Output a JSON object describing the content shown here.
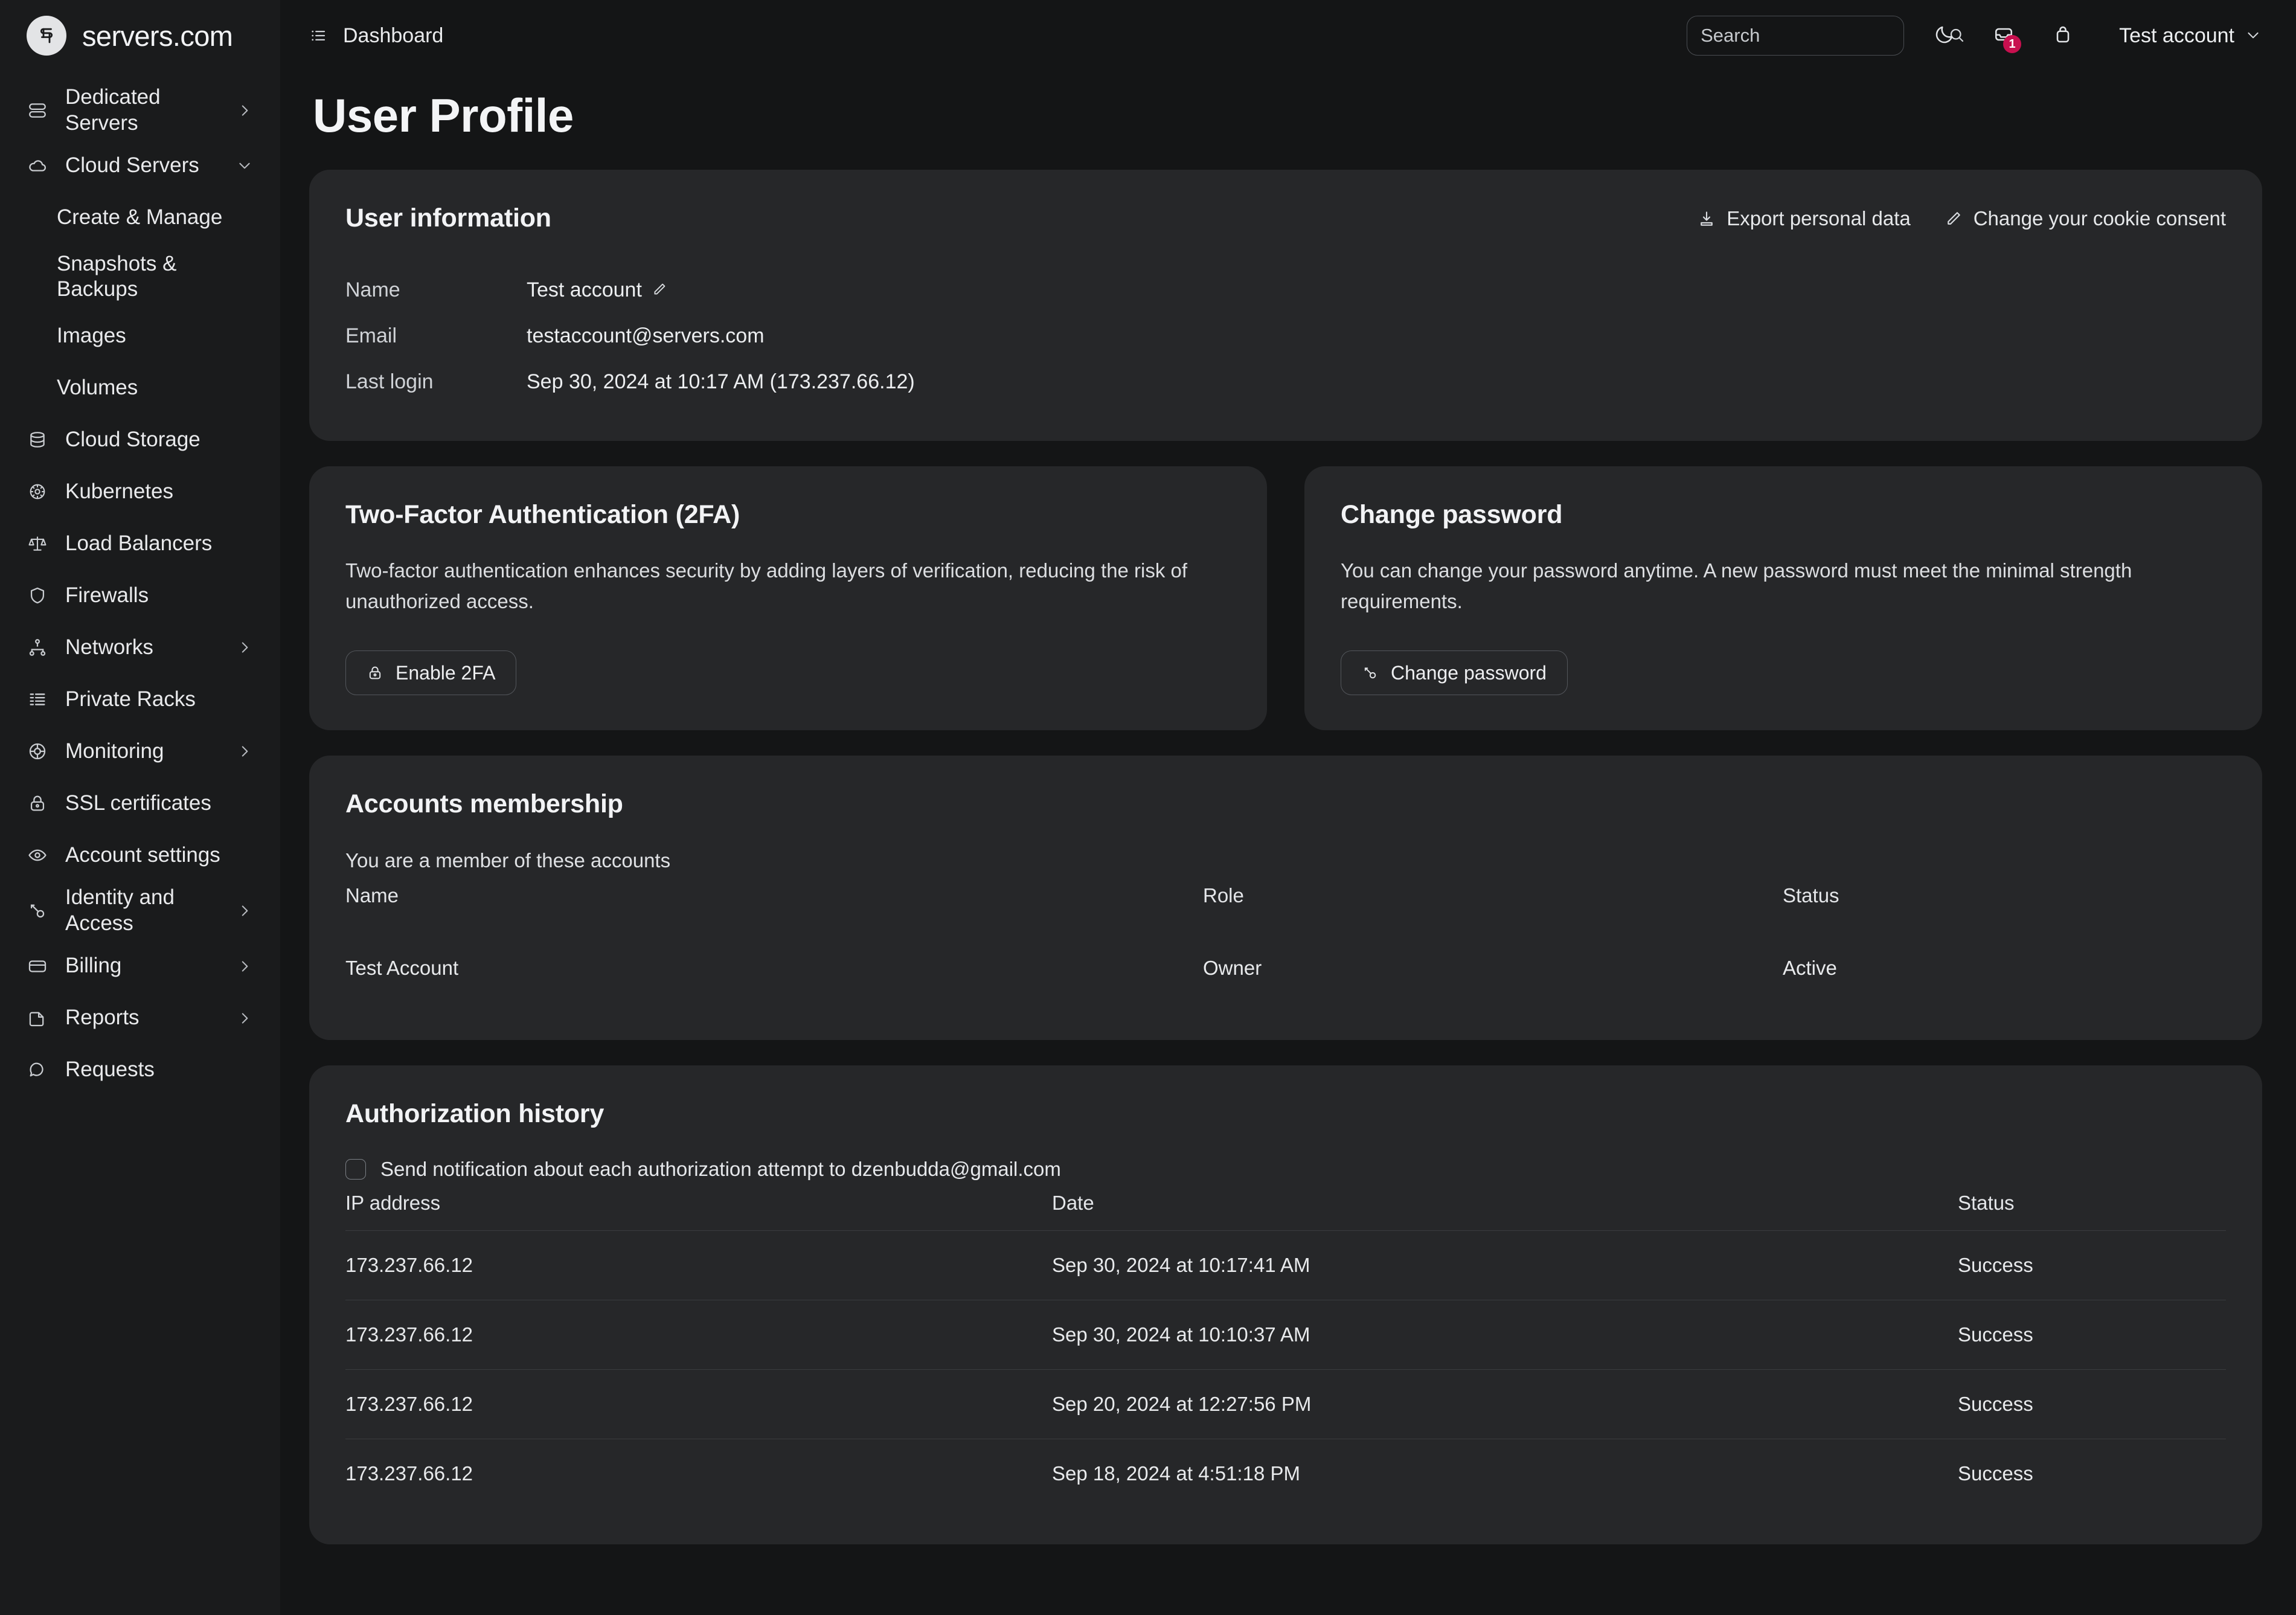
{
  "brand": {
    "name": "servers.com"
  },
  "sidebar": {
    "items": [
      {
        "label": "Dedicated Servers",
        "icon": "server-stack-icon",
        "chevron": "right",
        "sub": false
      },
      {
        "label": "Cloud Servers",
        "icon": "cloud-icon",
        "chevron": "down",
        "sub": false
      },
      {
        "label": "Create & Manage",
        "icon": "",
        "chevron": "",
        "sub": true
      },
      {
        "label": "Snapshots & Backups",
        "icon": "",
        "chevron": "",
        "sub": true
      },
      {
        "label": "Images",
        "icon": "",
        "chevron": "",
        "sub": true
      },
      {
        "label": "Volumes",
        "icon": "",
        "chevron": "",
        "sub": true
      },
      {
        "label": "Cloud Storage",
        "icon": "database-icon",
        "chevron": "",
        "sub": false
      },
      {
        "label": "Kubernetes",
        "icon": "kubernetes-helm-icon",
        "chevron": "",
        "sub": false
      },
      {
        "label": "Load Balancers",
        "icon": "scales-icon",
        "chevron": "",
        "sub": false
      },
      {
        "label": "Firewalls",
        "icon": "shield-icon",
        "chevron": "",
        "sub": false
      },
      {
        "label": "Networks",
        "icon": "network-tree-icon",
        "chevron": "right",
        "sub": false
      },
      {
        "label": "Private Racks",
        "icon": "rack-icon",
        "chevron": "",
        "sub": false
      },
      {
        "label": "Monitoring",
        "icon": "target-icon",
        "chevron": "right",
        "sub": false
      },
      {
        "label": "SSL certificates",
        "icon": "lock-icon",
        "chevron": "",
        "sub": false
      },
      {
        "label": "Account settings",
        "icon": "eye-icon",
        "chevron": "",
        "sub": false
      },
      {
        "label": "Identity and Access",
        "icon": "key-icon",
        "chevron": "right",
        "sub": false
      },
      {
        "label": "Billing",
        "icon": "credit-card-icon",
        "chevron": "right",
        "sub": false
      },
      {
        "label": "Reports",
        "icon": "document-icon",
        "chevron": "right",
        "sub": false
      },
      {
        "label": "Requests",
        "icon": "chat-bubble-icon",
        "chevron": "",
        "sub": false
      }
    ]
  },
  "topbar": {
    "breadcrumb": "Dashboard",
    "search": {
      "value": "",
      "placeholder": "Search"
    },
    "notifications_badge": "1",
    "account_label": "Test account"
  },
  "page": {
    "title": "User Profile"
  },
  "user_information": {
    "title": "User information",
    "actions": {
      "export": "Export personal data",
      "cookie_consent": "Change your cookie consent"
    },
    "rows": [
      {
        "label": "Name",
        "value": "Test account",
        "editable": true
      },
      {
        "label": "Email",
        "value": "testaccount@servers.com",
        "editable": false
      },
      {
        "label": "Last login",
        "value": "Sep 30, 2024 at 10:17 AM (173.237.66.12)",
        "editable": false
      }
    ]
  },
  "two_factor": {
    "title": "Two-Factor Authentication (2FA)",
    "description": "Two-factor authentication enhances security by adding layers of verification, reducing the risk of unauthorized access.",
    "button": "Enable 2FA"
  },
  "change_password": {
    "title": "Change password",
    "description": "You can change your password anytime. A new password must meet the minimal strength requirements.",
    "button": "Change password"
  },
  "accounts_membership": {
    "title": "Accounts membership",
    "subtitle": "You are a member of these accounts",
    "headers": {
      "name": "Name",
      "role": "Role",
      "status": "Status"
    },
    "rows": [
      {
        "name": "Test Account",
        "role": "Owner",
        "status": "Active"
      }
    ]
  },
  "authorization_history": {
    "title": "Authorization history",
    "notify_label": "Send notification about each authorization attempt to dzenbudda@gmail.com",
    "notify_checked": false,
    "headers": {
      "ip": "IP address",
      "date": "Date",
      "status": "Status"
    },
    "rows": [
      {
        "ip": "173.237.66.12",
        "date": "Sep 30, 2024 at 10:17:41 AM",
        "status": "Success"
      },
      {
        "ip": "173.237.66.12",
        "date": "Sep 30, 2024 at 10:10:37 AM",
        "status": "Success"
      },
      {
        "ip": "173.237.66.12",
        "date": "Sep 20, 2024 at 12:27:56 PM",
        "status": "Success"
      },
      {
        "ip": "173.237.66.12",
        "date": "Sep 18, 2024 at 4:51:18 PM",
        "status": "Success"
      }
    ]
  },
  "colors": {
    "page_bg": "#141516",
    "sidebar_bg": "#1a1b1c",
    "card_bg": "#262729",
    "badge": "#c8104f",
    "text": "#e9eaec"
  }
}
